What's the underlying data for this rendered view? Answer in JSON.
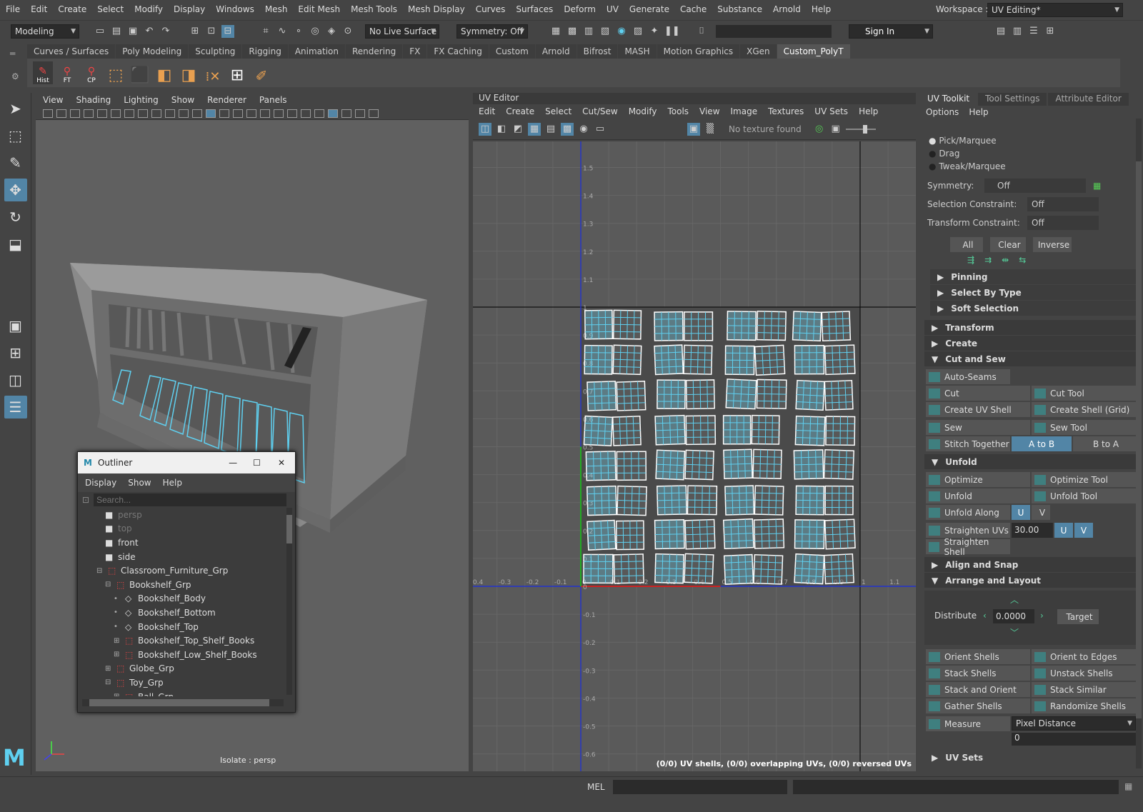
{
  "menubar": {
    "items": [
      "File",
      "Edit",
      "Create",
      "Select",
      "Modify",
      "Display",
      "Windows",
      "Mesh",
      "Edit Mesh",
      "Mesh Tools",
      "Mesh Display",
      "Curves",
      "Surfaces",
      "Deform",
      "UV",
      "Generate",
      "Cache",
      "Substance",
      "Arnold",
      "Help"
    ],
    "workspace_label": "Workspace :",
    "workspace_value": "UV Editing*"
  },
  "status": {
    "mode": "Modeling",
    "live_surface": "No Live Surface",
    "symmetry": "Symmetry: Off",
    "sign_in": "Sign In"
  },
  "shelf": {
    "tabs": [
      "Curves / Surfaces",
      "Poly Modeling",
      "Sculpting",
      "Rigging",
      "Animation",
      "Rendering",
      "FX",
      "FX Caching",
      "Custom",
      "Arnold",
      "Bifrost",
      "MASH",
      "Motion Graphics",
      "XGen",
      "Custom_PolyT"
    ],
    "active_tab": "Custom_PolyT",
    "buttons": [
      "Hist",
      "FT",
      "CP"
    ]
  },
  "viewport": {
    "menu": [
      "View",
      "Shading",
      "Lighting",
      "Show",
      "Renderer",
      "Panels"
    ],
    "status": "Isolate : persp"
  },
  "outliner": {
    "title": "Outliner",
    "menu": [
      "Display",
      "Show",
      "Help"
    ],
    "search_placeholder": "Search...",
    "rows": [
      {
        "label": "persp",
        "indent": 0,
        "dim": true,
        "icon": "camera-icon"
      },
      {
        "label": "top",
        "indent": 0,
        "dim": true,
        "icon": "camera-icon"
      },
      {
        "label": "front",
        "indent": 0,
        "dim": false,
        "icon": "camera-icon"
      },
      {
        "label": "side",
        "indent": 0,
        "dim": false,
        "icon": "camera-icon"
      },
      {
        "label": "Classroom_Furniture_Grp",
        "indent": 0,
        "dim": false,
        "icon": "group-icon",
        "exp": "−"
      },
      {
        "label": "Bookshelf_Grp",
        "indent": 1,
        "dim": false,
        "icon": "group-icon",
        "exp": "−"
      },
      {
        "label": "Bookshelf_Body",
        "indent": 2,
        "dim": false,
        "icon": "mesh-icon"
      },
      {
        "label": "Bookshelf_Bottom",
        "indent": 2,
        "dim": false,
        "icon": "mesh-icon"
      },
      {
        "label": "Bookshelf_Top",
        "indent": 2,
        "dim": false,
        "icon": "mesh-icon"
      },
      {
        "label": "Bookshelf_Top_Shelf_Books",
        "indent": 2,
        "dim": false,
        "icon": "group-icon",
        "exp": "+"
      },
      {
        "label": "Bookshelf_Low_Shelf_Books",
        "indent": 2,
        "dim": false,
        "icon": "group-icon",
        "exp": "+"
      },
      {
        "label": "Globe_Grp",
        "indent": 1,
        "dim": false,
        "icon": "group-icon",
        "exp": "+"
      },
      {
        "label": "Toy_Grp",
        "indent": 1,
        "dim": false,
        "icon": "group-icon",
        "exp": "−"
      },
      {
        "label": "Ball_Grp",
        "indent": 2,
        "dim": false,
        "icon": "group-icon",
        "exp": "+"
      }
    ]
  },
  "uv_editor": {
    "title": "UV Editor",
    "menu": [
      "Edit",
      "Create",
      "Select",
      "Cut/Sew",
      "Modify",
      "Tools",
      "View",
      "Image",
      "Textures",
      "UV Sets",
      "Help"
    ],
    "texture_status": "No texture found",
    "axis_v": [
      "1.5",
      "1.4",
      "1.3",
      "1.2",
      "1.1",
      "1",
      "0.9",
      "0.8",
      "0.7",
      "0.6",
      "0.5",
      "0.4",
      "0.3",
      "0.2",
      "0.1",
      "0",
      "-0.1",
      "-0.2",
      "-0.3",
      "-0.4",
      "-0.5",
      "-0.6"
    ],
    "axis_u": [
      "-0.4",
      "-0.3",
      "-0.2",
      "-0.1",
      "0",
      "0.1",
      "0.2",
      "0.3",
      "0.4",
      "0.5",
      "0.6",
      "0.7",
      "0.8",
      "0.9",
      "1",
      "1.1"
    ],
    "status": "(0/0) UV shells, (0/0) overlapping UVs, (0/0) reversed UVs"
  },
  "uv_toolkit": {
    "tabs": [
      "UV Toolkit",
      "Tool Settings",
      "Attribute Editor"
    ],
    "menu": [
      "Options",
      "Help"
    ],
    "radio": [
      "Pick/Marquee",
      "Drag",
      "Tweak/Marquee"
    ],
    "symmetry_label": "Symmetry:",
    "symmetry_value": "Off",
    "sel_constraint_label": "Selection Constraint:",
    "sel_constraint_value": "Off",
    "trans_constraint_label": "Transform Constraint:",
    "trans_constraint_value": "Off",
    "buttons_all": "All",
    "buttons_clear": "Clear",
    "buttons_inverse": "Inverse",
    "sections_sub": [
      "Pinning",
      "Select By Type",
      "Soft Selection"
    ],
    "transform": "Transform",
    "create": "Create",
    "cut_and_sew": "Cut and Sew",
    "auto_seams": "Auto-Seams",
    "cut": "Cut",
    "cut_tool": "Cut Tool",
    "create_uv_shell": "Create UV Shell",
    "create_shell_grid": "Create Shell (Grid)",
    "sew": "Sew",
    "sew_tool": "Sew Tool",
    "stitch_together": "Stitch Together",
    "a_to_b": "A to B",
    "b_to_a": "B to A",
    "unfold_section": "Unfold",
    "optimize": "Optimize",
    "optimize_tool": "Optimize Tool",
    "unfold": "Unfold",
    "unfold_tool": "Unfold Tool",
    "unfold_along": "Unfold Along",
    "u": "U",
    "v": "V",
    "straighten_uvs": "Straighten UVs",
    "straighten_value": "30.00",
    "straighten_shell": "Straighten Shell",
    "align_snap": "Align and Snap",
    "arrange_layout": "Arrange and Layout",
    "distribute": "Distribute",
    "distribute_value": "0.0000",
    "target": "Target",
    "orient_shells": "Orient Shells",
    "orient_edges": "Orient to Edges",
    "stack_shells": "Stack Shells",
    "unstack_shells": "Unstack Shells",
    "stack_orient": "Stack and Orient",
    "stack_similar": "Stack Similar",
    "gather_shells": "Gather Shells",
    "randomize_shells": "Randomize Shells",
    "measure": "Measure",
    "measure_mode": "Pixel Distance",
    "measure_value": "0",
    "uv_sets": "UV Sets"
  },
  "command": {
    "lang": "MEL"
  },
  "colors": {
    "accent": "#5285a6",
    "uv_shell": "#5fd0f0",
    "bg": "#444444"
  }
}
